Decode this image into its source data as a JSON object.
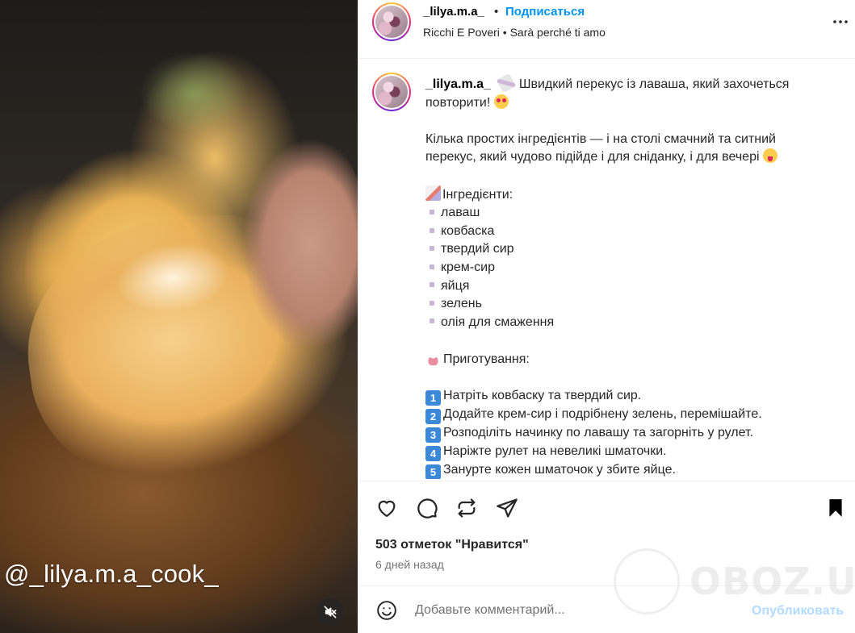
{
  "media": {
    "overlay_text": "@_lilya.m.a_cook_",
    "mute_icon": "speaker-muted-icon"
  },
  "header": {
    "username": "_lilya.m.a_",
    "separator": "•",
    "follow_label": "Подписаться",
    "audio": "Ricchi E Poveri • Sarà perché ti amo",
    "more_icon": "more-horizontal-icon"
  },
  "caption": {
    "username": "_lilya.m.a_",
    "line1": "Швидкий перекус із лаваша, який захочеться повторити!",
    "line2": "Кілька простих інгредієнтів — і на столі смачний та ситний перекус, який чудово підійде і для сніданку, і для вечері",
    "ingredients_title": "Інгредієнти:",
    "ingredients": [
      "лаваш",
      "ковбаска",
      "твердий сир",
      "крем-сир",
      "яйця",
      "зелень",
      "олія для смаження"
    ],
    "steps_title": "Приготування:",
    "steps": [
      {
        "n": "1",
        "text": "Натріть ковбаску та твердий сир."
      },
      {
        "n": "2",
        "text": "Додайте крем-сир і подрібнену зелень, перемішайте."
      },
      {
        "n": "3",
        "text": "Розподіліть начинку по лавашу та загорніть у рулет."
      },
      {
        "n": "4",
        "text": "Наріжте рулет на невеликі шматочки."
      },
      {
        "n": "5",
        "text": "Занурте кожен шматочок у збите яйце."
      }
    ]
  },
  "actions": {
    "like_icon": "heart-icon",
    "comment_icon": "comment-icon",
    "repost_icon": "repost-icon",
    "share_icon": "send-icon",
    "save_icon": "bookmark-icon"
  },
  "likes_text": "503 отметок \"Нравится\"",
  "date_text": "6 дней назад",
  "comment": {
    "emoji_icon": "smiley-icon",
    "placeholder": "Добавьте комментарий...",
    "value": "",
    "publish_label": "Опубликовать"
  },
  "site_watermark": "OBOZ.UA",
  "colors": {
    "link_blue": "#0095f6",
    "publish_disabled": "#b3dbff",
    "text": "#262626",
    "secondary_text": "#737373",
    "divider": "#efefef"
  }
}
